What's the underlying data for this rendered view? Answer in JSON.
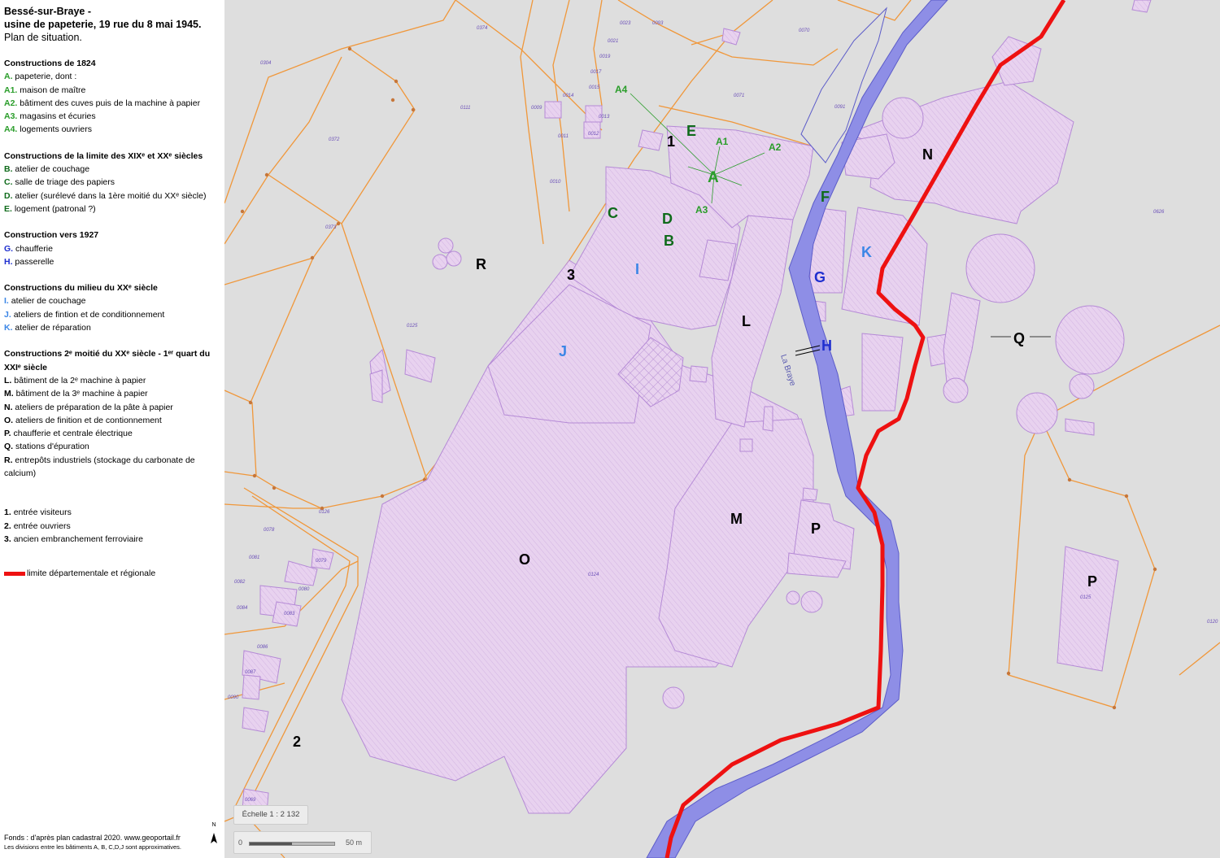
{
  "title_line1": "Bessé-sur-Braye -",
  "title_line2": "usine de papeterie, 19 rue du 8 mai 1945.",
  "subtitle": "Plan de situation.",
  "sections": {
    "s1824": {
      "heading": "Constructions de 1824",
      "items": [
        {
          "code": "A.",
          "text": "papeterie, dont :"
        },
        {
          "code": "A1.",
          "text": "maison de maître"
        },
        {
          "code": "A2.",
          "text": "bâtiment des cuves puis de la machine à papier"
        },
        {
          "code": "A3.",
          "text": "magasins et écuries"
        },
        {
          "code": "A4.",
          "text": "logements ouvriers"
        }
      ]
    },
    "s1900": {
      "heading": "Constructions de la limite des XIXᵉ et XXᵉ siècles",
      "items": [
        {
          "code": "B.",
          "text": "atelier de couchage"
        },
        {
          "code": "C.",
          "text": "salle de triage des papiers"
        },
        {
          "code": "D.",
          "text": "atelier (surélevé dans la 1ère moitié du XXᵉ siècle)"
        },
        {
          "code": "E.",
          "text": "logement (patronal ?)"
        }
      ]
    },
    "s1927": {
      "heading": "Construction vers 1927",
      "items": [
        {
          "code": "G.",
          "text": "chaufferie"
        },
        {
          "code": "H.",
          "text": "passerelle"
        }
      ]
    },
    "s1950": {
      "heading": "Constructions du milieu du XXᵉ siècle",
      "items": [
        {
          "code": "I.",
          "text": "atelier de couchage"
        },
        {
          "code": "J.",
          "text": "ateliers de fintion et de conditionnement"
        },
        {
          "code": "K.",
          "text": "atelier de réparation"
        }
      ]
    },
    "s2000": {
      "heading": "Constructions 2ᵉ moitié du XXᵉ siècle - 1ᵉʳ quart du XXIᵉ siècle",
      "items": [
        {
          "code": "L.",
          "text": "bâtiment de la 2ᵉ machine à papier"
        },
        {
          "code": "M.",
          "text": "bâtiment de la 3ᵉ machine à papier"
        },
        {
          "code": "N.",
          "text": "ateliers de préparation de la pâte à papier"
        },
        {
          "code": "O.",
          "text": "ateliers de finition et de contionnement"
        },
        {
          "code": "P.",
          "text": "chaufferie et centrale électrique"
        },
        {
          "code": "Q.",
          "text": "stations d'épuration"
        },
        {
          "code": "R.",
          "text": "entrepôts industriels (stockage du carbonate de calcium)"
        }
      ]
    },
    "entrances": {
      "items": [
        {
          "code": "1.",
          "text": "entrée visiteurs"
        },
        {
          "code": "2.",
          "text": "entrée ouvriers"
        },
        {
          "code": "3.",
          "text": "ancien embranchement ferroviaire"
        }
      ]
    }
  },
  "limit_label": "limite départementale et régionale",
  "footer_line1": "Fonds : d'après plan cadastral 2020. www.geoportail.fr",
  "footer_line2": "Les divisions entre les bâtiments A, B, C,D,J sont approximatives.",
  "north_label": "N",
  "scale_label": "Échelle 1 : 2 132",
  "scalebar_zero": "0",
  "scalebar_fifty": "50 m",
  "river_name": "La Braye",
  "map_labels": {
    "A": "A",
    "A1": "A1",
    "A2": "A2",
    "A3": "A3",
    "A4": "A4",
    "B": "B",
    "C": "C",
    "D": "D",
    "E": "E",
    "F": "F",
    "G": "G",
    "H": "H",
    "I": "I",
    "J": "J",
    "K": "K",
    "L": "L",
    "M": "M",
    "N": "N",
    "O": "O",
    "P": "P",
    "P2": "P",
    "Q": "Q",
    "R": "R",
    "n1": "1",
    "n2": "2",
    "n3": "3"
  },
  "parcels": [
    "0374",
    "0023",
    "0093",
    "0070",
    "0304",
    "0021",
    "0019",
    "0017",
    "0015",
    "0014",
    "0013",
    "0012",
    "0011",
    "0009",
    "0111",
    "0071",
    "0091",
    "0372",
    "0010",
    "0373",
    "0125",
    "0126",
    "0078",
    "0079",
    "0081",
    "0080",
    "0082",
    "0084",
    "0083",
    "0086",
    "0087",
    "0090",
    "0124",
    "0125",
    "0626",
    "0069",
    "0070",
    "0120"
  ],
  "colors": {
    "building_fill": "#e6cdee",
    "building_stroke": "#b58ad6",
    "parcel_line": "#f0973a",
    "river": "#8e8ee6",
    "limit": "#ee1111",
    "background": "#dedede",
    "green": "#2a9d2a",
    "dark_green": "#0f6b1b",
    "blue": "#1f2fcf",
    "light_blue": "#3b86e6"
  }
}
